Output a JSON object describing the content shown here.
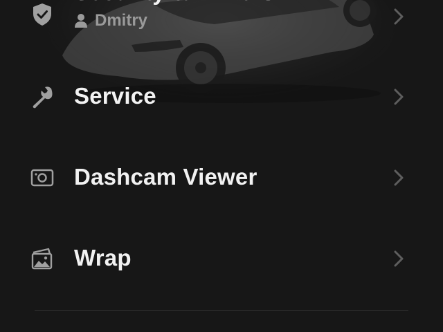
{
  "menu": {
    "security": {
      "label": "Security & Drivers",
      "driver_name": "Dmitry",
      "icon": "shield-check-icon"
    },
    "service": {
      "label": "Service",
      "icon": "wrench-icon"
    },
    "dashcam": {
      "label": "Dashcam Viewer",
      "icon": "camera-icon"
    },
    "wrap": {
      "label": "Wrap",
      "icon": "image-gallery-icon"
    }
  },
  "colors": {
    "background": "#171717",
    "label": "#f2f2f2",
    "icon": "#a0a0a0",
    "chevron": "#5e5e5e",
    "divider": "#333333"
  }
}
